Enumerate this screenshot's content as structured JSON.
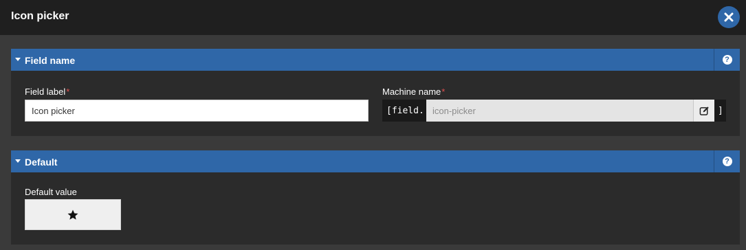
{
  "dialog": {
    "title": "Icon picker",
    "close_icon": "close-icon"
  },
  "sections": {
    "field_name": {
      "title": "Field name",
      "help_symbol": "?",
      "field_label": {
        "label": "Field label",
        "required_mark": "*",
        "value": "Icon picker"
      },
      "machine_name": {
        "label": "Machine name",
        "required_mark": "*",
        "prefix": "[field.",
        "value": "icon-picker",
        "suffix": "]",
        "edit_icon": "edit-icon"
      }
    },
    "default": {
      "title": "Default",
      "help_symbol": "?",
      "default_value": {
        "label": "Default value",
        "icon": "star-icon"
      }
    }
  },
  "colors": {
    "header_bar": "#1f1f1f",
    "section_header": "#2f67a8",
    "close_button": "#2f67a8",
    "required": "#e05050"
  }
}
